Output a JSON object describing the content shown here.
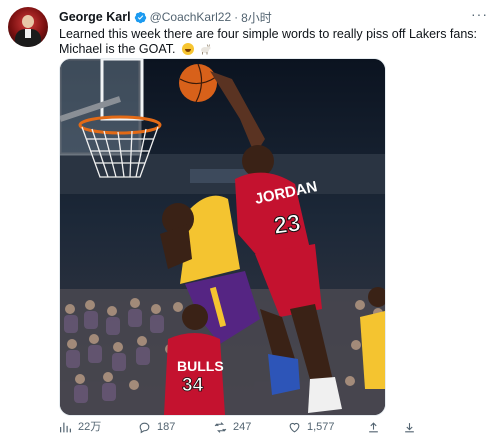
{
  "tweet": {
    "author": {
      "display_name": "George Karl",
      "handle": "@CoachKarl22",
      "verified": true,
      "avatar": "avatar-photo"
    },
    "separator": "·",
    "timestamp": "8小时",
    "text": "Learned this week there are four simple words to really piss off Lakers fans: Michael is the GOAT.",
    "emojis": [
      "grinning-squinting-face",
      "goat"
    ],
    "media": {
      "type": "photo",
      "description_icon": "basketball-dunk-photo",
      "jersey_texts": [
        "JORDAN",
        "23",
        "BULLS",
        "34"
      ]
    },
    "actions": {
      "views": "22万",
      "replies": "187",
      "retweets": "247",
      "likes": "1,577"
    },
    "icons": [
      "verified-badge-icon",
      "more-icon",
      "views-icon",
      "reply-icon",
      "retweet-icon",
      "like-icon",
      "share-icon",
      "bookmark-icon"
    ],
    "colors": {
      "text": "#0f1419",
      "secondary_text": "#536471",
      "verified_badge": "#1d9bf0",
      "bulls_red": "#c4122f",
      "lakers_gold": "#f4c430",
      "lakers_purple": "#552583"
    }
  }
}
